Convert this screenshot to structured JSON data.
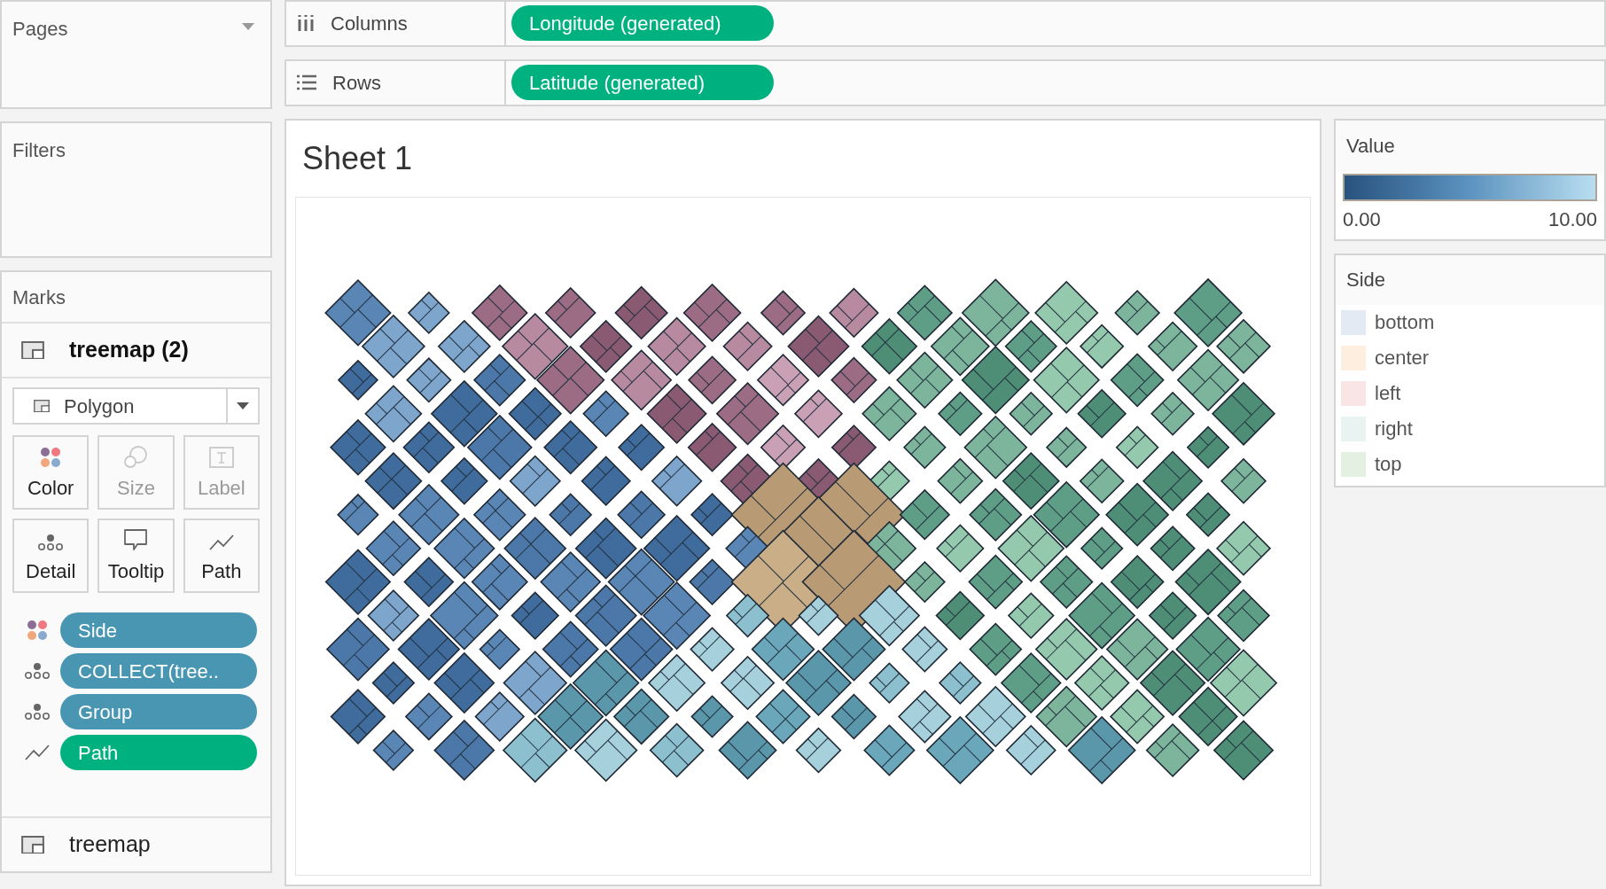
{
  "pages": {
    "title": "Pages"
  },
  "filters": {
    "title": "Filters"
  },
  "shelves": [
    {
      "kind": "columns",
      "label": "Columns",
      "pill": "Longitude (generated)"
    },
    {
      "kind": "rows",
      "label": "Rows",
      "pill": "Latitude (generated)"
    }
  ],
  "marks": {
    "title": "Marks",
    "layers": [
      {
        "label": "treemap (2)",
        "selected": true
      },
      {
        "label": "treemap",
        "selected": false
      }
    ],
    "mark_type": "Polygon",
    "properties": [
      {
        "kind": "color",
        "label": "Color",
        "disabled": false
      },
      {
        "kind": "size",
        "label": "Size",
        "disabled": true
      },
      {
        "kind": "label",
        "label": "Label",
        "disabled": true
      },
      {
        "kind": "detail",
        "label": "Detail",
        "disabled": false
      },
      {
        "kind": "tooltip",
        "label": "Tooltip",
        "disabled": false
      },
      {
        "kind": "path",
        "label": "Path",
        "disabled": false
      }
    ],
    "fields": [
      {
        "kind": "color",
        "label": "Side",
        "color": "#4996b2"
      },
      {
        "kind": "detail",
        "label": "COLLECT(tree..",
        "color": "#4996b2"
      },
      {
        "kind": "detail",
        "label": "Group",
        "color": "#4996b2"
      },
      {
        "kind": "path",
        "label": "Path",
        "color": "#00b180"
      }
    ]
  },
  "sheet": {
    "title": "Sheet 1"
  },
  "value_legend": {
    "title": "Value",
    "min_label": "0.00",
    "max_label": "10.00"
  },
  "side_legend": {
    "title": "Side",
    "items": [
      {
        "label": "bottom",
        "color": "#e3eaf3"
      },
      {
        "label": "center",
        "color": "#fdeee0"
      },
      {
        "label": "left",
        "color": "#f9e4e6"
      },
      {
        "label": "right",
        "color": "#e9f3f1"
      },
      {
        "label": "top",
        "color": "#e4f0e2"
      }
    ]
  }
}
